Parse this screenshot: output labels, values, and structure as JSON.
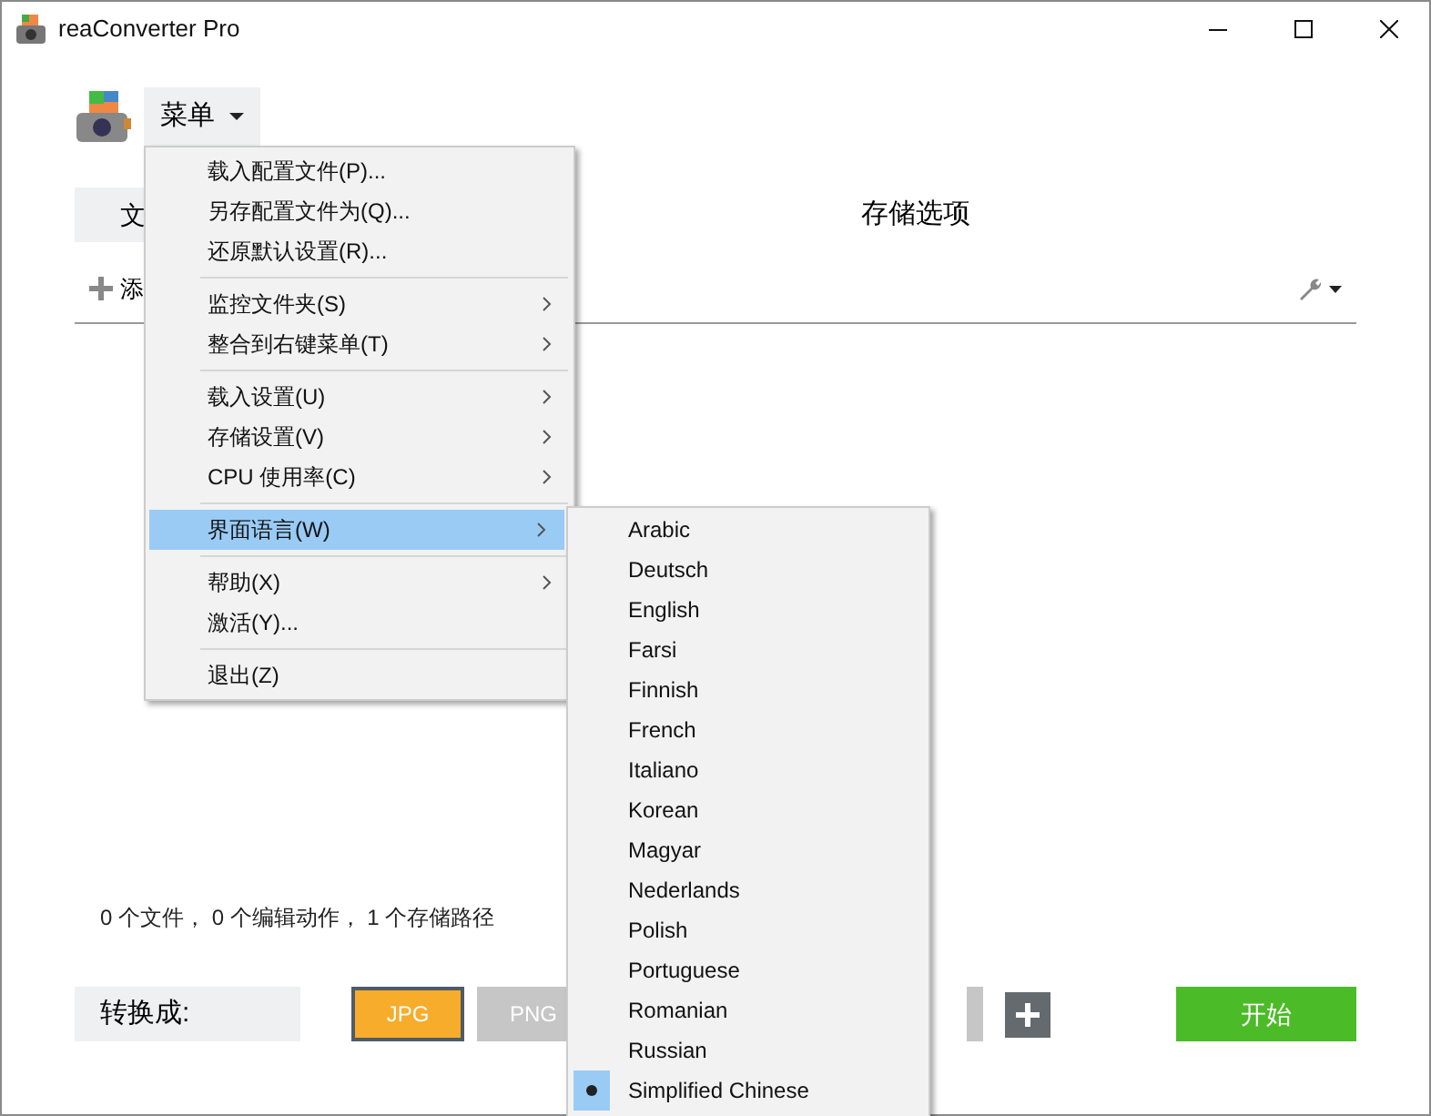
{
  "window": {
    "title": "reaConverter Pro"
  },
  "menu_button": {
    "label": "菜单"
  },
  "tabs": [
    {
      "label": "文",
      "selected": true
    },
    {
      "label": "存储选项",
      "selected": false
    }
  ],
  "toolbar": {
    "add_label": "添"
  },
  "status": "0 个文件， 0 个编辑动作， 1 个存储路径",
  "convert_label": "转换成:",
  "formats": [
    {
      "label": "JPG",
      "selected": true
    },
    {
      "label": "PNG",
      "selected": false
    },
    {
      "selected": false
    }
  ],
  "start_button": "开始",
  "menu": {
    "groups": [
      [
        {
          "label": "载入配置文件(P)...",
          "submenu": false,
          "selected": false
        },
        {
          "label": "另存配置文件为(Q)...",
          "submenu": false,
          "selected": false
        },
        {
          "label": "还原默认设置(R)...",
          "submenu": false,
          "selected": false
        }
      ],
      [
        {
          "label": "监控文件夹(S)",
          "submenu": true,
          "selected": false
        },
        {
          "label": "整合到右键菜单(T)",
          "submenu": true,
          "selected": false
        }
      ],
      [
        {
          "label": "载入设置(U)",
          "submenu": true,
          "selected": false
        },
        {
          "label": "存储设置(V)",
          "submenu": true,
          "selected": false
        },
        {
          "label": "CPU 使用率(C)",
          "submenu": true,
          "selected": false
        }
      ],
      [
        {
          "label": "界面语言(W)",
          "submenu": true,
          "selected": true
        }
      ],
      [
        {
          "label": "帮助(X)",
          "submenu": true,
          "selected": false
        },
        {
          "label": "激活(Y)...",
          "submenu": false,
          "selected": false
        }
      ],
      [
        {
          "label": "退出(Z)",
          "submenu": false,
          "selected": false
        }
      ]
    ]
  },
  "language_menu": [
    {
      "label": "Arabic",
      "checked": false
    },
    {
      "label": "Deutsch",
      "checked": false
    },
    {
      "label": "English",
      "checked": false
    },
    {
      "label": "Farsi",
      "checked": false
    },
    {
      "label": "Finnish",
      "checked": false
    },
    {
      "label": "French",
      "checked": false
    },
    {
      "label": "Italiano",
      "checked": false
    },
    {
      "label": "Korean",
      "checked": false
    },
    {
      "label": "Magyar",
      "checked": false
    },
    {
      "label": "Nederlands",
      "checked": false
    },
    {
      "label": "Polish",
      "checked": false
    },
    {
      "label": "Portuguese",
      "checked": false
    },
    {
      "label": "Romanian",
      "checked": false
    },
    {
      "label": "Russian",
      "checked": false
    },
    {
      "label": "Simplified Chinese",
      "checked": true
    }
  ]
}
